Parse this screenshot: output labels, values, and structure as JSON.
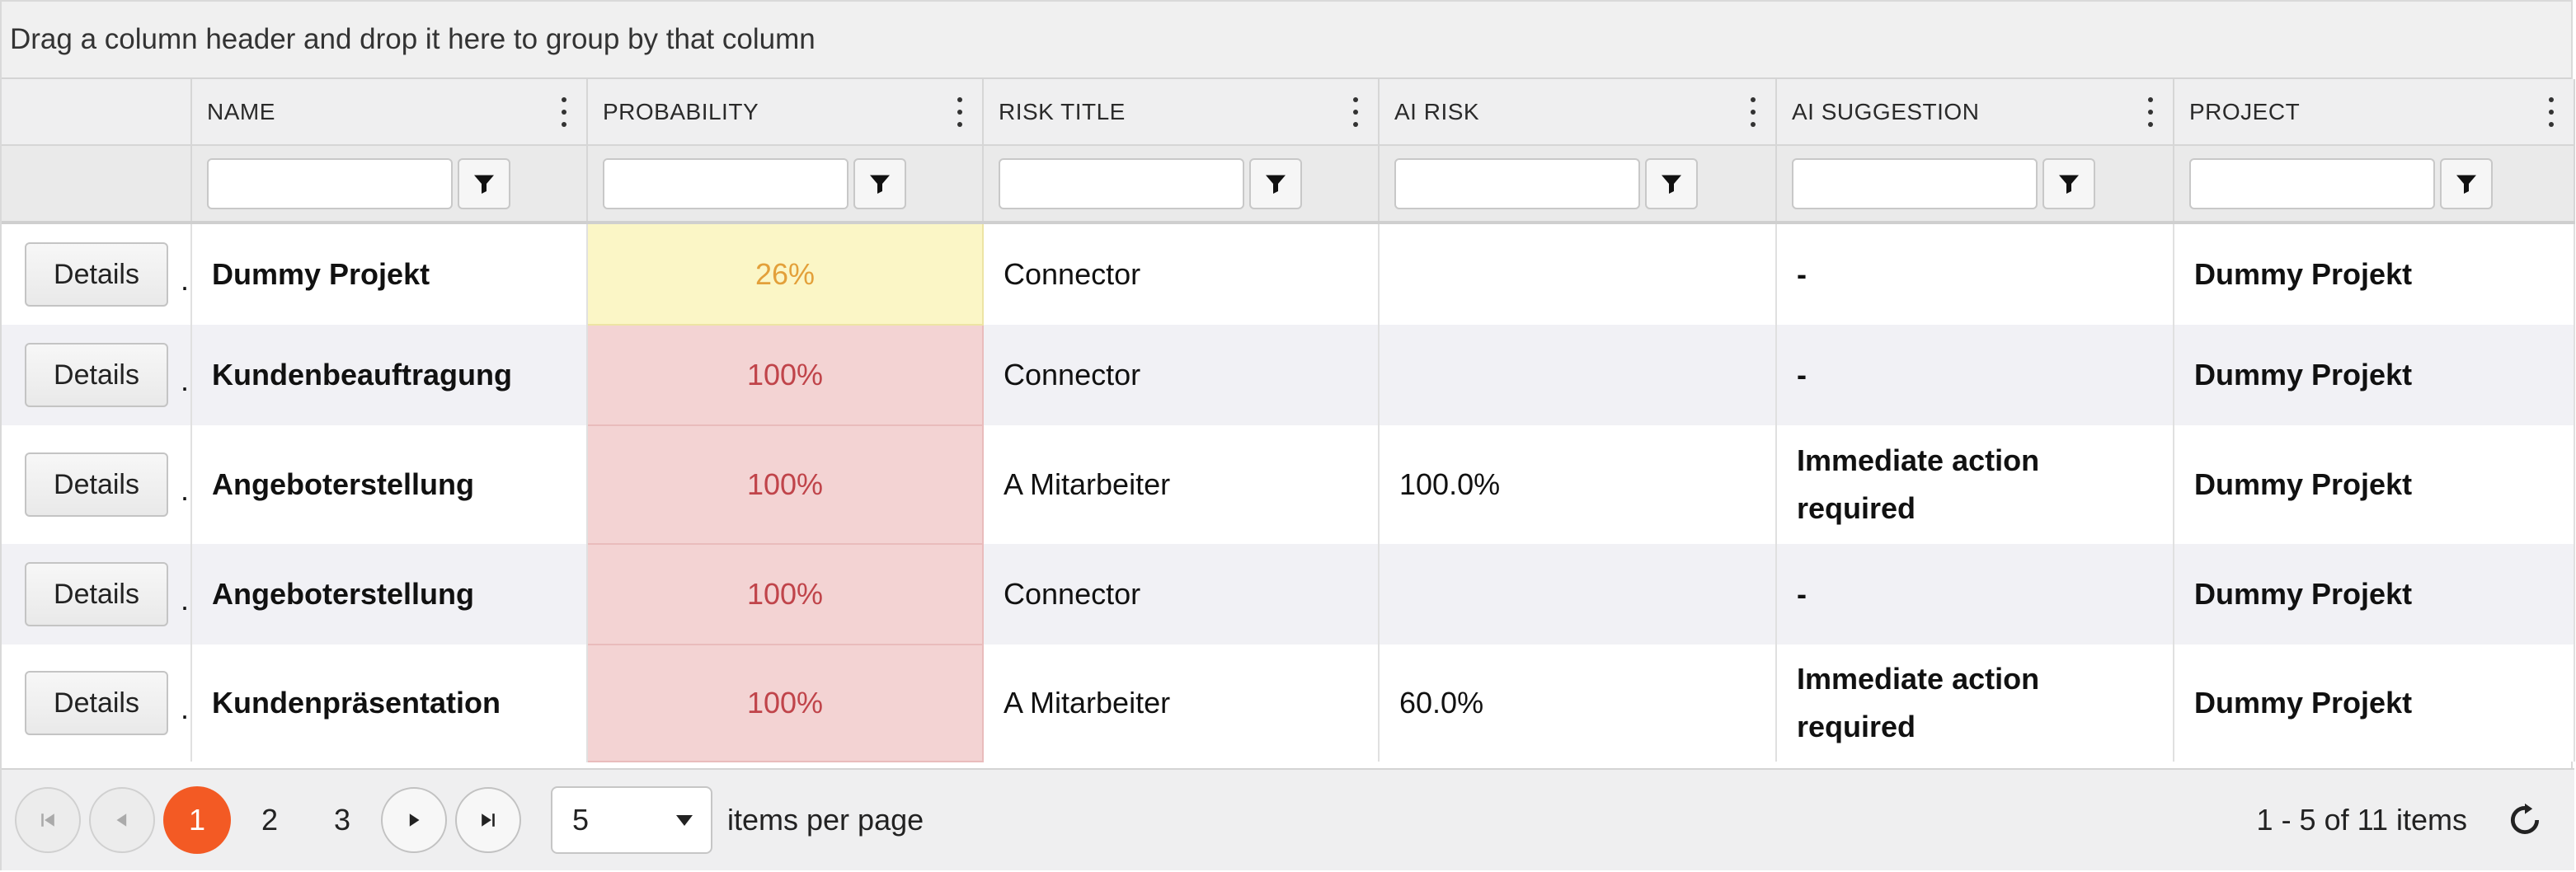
{
  "group_bar": {
    "text": "Drag a column header and drop it here to group by that column"
  },
  "columns": [
    {
      "label": "NAME"
    },
    {
      "label": "PROBABILITY"
    },
    {
      "label": "RISK TITLE"
    },
    {
      "label": "AI RISK"
    },
    {
      "label": "AI SUGGESTION"
    },
    {
      "label": "PROJECT"
    }
  ],
  "filters": {
    "name": "",
    "probability": "",
    "risk_title": "",
    "ai_risk": "",
    "ai_suggestion": "",
    "project": ""
  },
  "command": {
    "details_label": "Details",
    "separator": "."
  },
  "rows": [
    {
      "name": "Dummy Projekt",
      "probability": "26%",
      "probability_level": "yellow",
      "risk_title": "Connector",
      "ai_risk": "",
      "ai_suggestion": "-",
      "project": "Dummy Projekt"
    },
    {
      "name": "Kundenbeauftragung",
      "probability": "100%",
      "probability_level": "red",
      "risk_title": "Connector",
      "ai_risk": "",
      "ai_suggestion": "-",
      "project": "Dummy Projekt"
    },
    {
      "name": "Angeboterstellung",
      "probability": "100%",
      "probability_level": "red",
      "risk_title": "A Mitarbeiter",
      "ai_risk": "100.0%",
      "ai_suggestion": "Immediate action required",
      "project": "Dummy Projekt"
    },
    {
      "name": "Angeboterstellung",
      "probability": "100%",
      "probability_level": "red",
      "risk_title": "Connector",
      "ai_risk": "",
      "ai_suggestion": "-",
      "project": "Dummy Projekt"
    },
    {
      "name": "Kundenpräsentation",
      "probability": "100%",
      "probability_level": "red",
      "risk_title": "A Mitarbeiter",
      "ai_risk": "60.0%",
      "ai_suggestion": "Immediate action required",
      "project": "Dummy Projekt"
    }
  ],
  "pager": {
    "pages": [
      "1",
      "2",
      "3"
    ],
    "current_page": "1",
    "page_size": "5",
    "per_page_label": "items per page",
    "range_text": "1 - 5 of 11 items"
  },
  "colors": {
    "accent": "#f35a24",
    "prob_yellow_bg": "#fbf6c6",
    "prob_yellow_text": "#e3a03a",
    "prob_red_bg": "#f3d3d3",
    "prob_red_text": "#c0444a"
  },
  "icons": {
    "filter": "filter-icon",
    "first": "first-page-icon",
    "prev": "previous-page-icon",
    "next": "next-page-icon",
    "last": "last-page-icon",
    "refresh": "refresh-icon",
    "column_menu": "column-menu-icon"
  }
}
